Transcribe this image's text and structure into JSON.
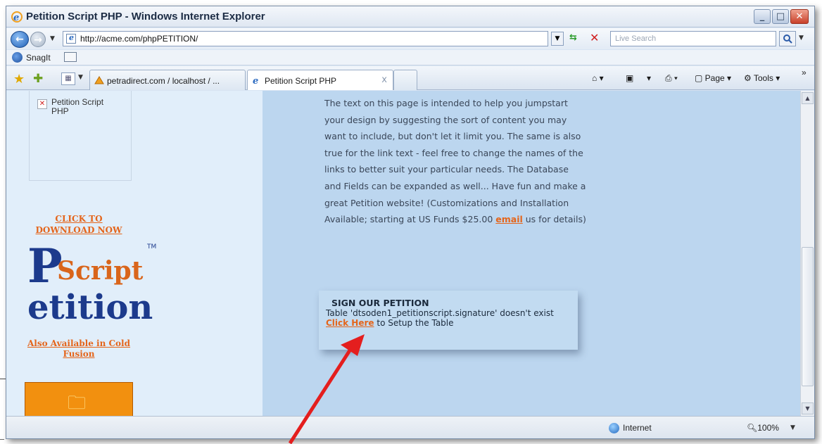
{
  "window": {
    "title": "Petition Script PHP - Windows Internet Explorer",
    "min_label": "_",
    "max_label": "□",
    "close_label": "✕"
  },
  "nav": {
    "url": "http://acme.com/phpPETITION/",
    "search_placeholder": "Live Search"
  },
  "links_bar": {
    "snagit_label": "SnagIt"
  },
  "tabs": [
    {
      "label": "petradirect.com / localhost / ..."
    },
    {
      "label": "Petition Script PHP",
      "close": "x"
    }
  ],
  "command_bar": {
    "page_label": "Page",
    "tools_label": "Tools"
  },
  "sidebar": {
    "broken_image_alt": "Petition Script PHP",
    "download_link": "CLICK TO DOWNLOAD NOW",
    "logo_word1": "Script",
    "logo_word2": "etition",
    "logo_tm": "TM",
    "coldfusion_link": "Also Available in Cold Fusion"
  },
  "main": {
    "intro_text": "The text on this page is intended to help you jumpstart your design by suggesting the sort of content you may want to include, but don't let it limit you. The same is also true for the link text - feel free to change the names of the links to better suit your particular needs. The Database and Fields can be expanded as well... Have fun and make a great Petition website! (Customizations and Installation Available; starting at US Funds $25.00 ",
    "email_link": "email",
    "intro_tail": " us for details)",
    "petition_title": "SIGN OUR PETITION",
    "petition_error": "Table 'dtsoden1_petitionscript.signature' doesn't exist ",
    "click_here": "Click Here",
    "petition_tail": " to Setup the Table"
  },
  "status": {
    "zone": "Internet",
    "zoom": "100%"
  },
  "colors": {
    "accent_link": "#e4651b",
    "content_bg": "#bcd6ef",
    "annotation_arrow": "#e41e1e"
  }
}
